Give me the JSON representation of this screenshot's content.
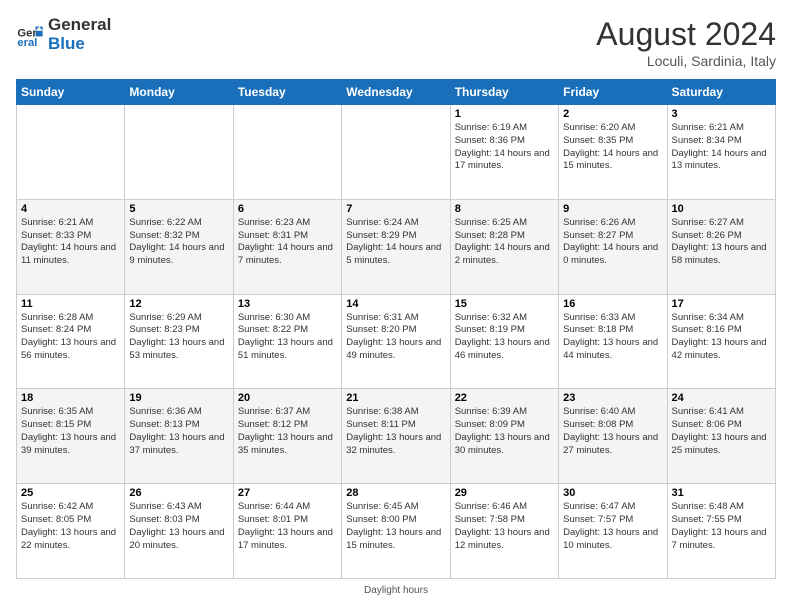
{
  "logo": {
    "line1": "General",
    "line2": "Blue"
  },
  "title": "August 2024",
  "subtitle": "Loculi, Sardinia, Italy",
  "footer": "Daylight hours",
  "weekdays": [
    "Sunday",
    "Monday",
    "Tuesday",
    "Wednesday",
    "Thursday",
    "Friday",
    "Saturday"
  ],
  "weeks": [
    [
      null,
      null,
      null,
      null,
      {
        "day": 1,
        "sunrise": "6:19 AM",
        "sunset": "8:36 PM",
        "daylight": "14 hours and 17 minutes."
      },
      {
        "day": 2,
        "sunrise": "6:20 AM",
        "sunset": "8:35 PM",
        "daylight": "14 hours and 15 minutes."
      },
      {
        "day": 3,
        "sunrise": "6:21 AM",
        "sunset": "8:34 PM",
        "daylight": "14 hours and 13 minutes."
      }
    ],
    [
      {
        "day": 4,
        "sunrise": "6:21 AM",
        "sunset": "8:33 PM",
        "daylight": "14 hours and 11 minutes."
      },
      {
        "day": 5,
        "sunrise": "6:22 AM",
        "sunset": "8:32 PM",
        "daylight": "14 hours and 9 minutes."
      },
      {
        "day": 6,
        "sunrise": "6:23 AM",
        "sunset": "8:31 PM",
        "daylight": "14 hours and 7 minutes."
      },
      {
        "day": 7,
        "sunrise": "6:24 AM",
        "sunset": "8:29 PM",
        "daylight": "14 hours and 5 minutes."
      },
      {
        "day": 8,
        "sunrise": "6:25 AM",
        "sunset": "8:28 PM",
        "daylight": "14 hours and 2 minutes."
      },
      {
        "day": 9,
        "sunrise": "6:26 AM",
        "sunset": "8:27 PM",
        "daylight": "14 hours and 0 minutes."
      },
      {
        "day": 10,
        "sunrise": "6:27 AM",
        "sunset": "8:26 PM",
        "daylight": "13 hours and 58 minutes."
      }
    ],
    [
      {
        "day": 11,
        "sunrise": "6:28 AM",
        "sunset": "8:24 PM",
        "daylight": "13 hours and 56 minutes."
      },
      {
        "day": 12,
        "sunrise": "6:29 AM",
        "sunset": "8:23 PM",
        "daylight": "13 hours and 53 minutes."
      },
      {
        "day": 13,
        "sunrise": "6:30 AM",
        "sunset": "8:22 PM",
        "daylight": "13 hours and 51 minutes."
      },
      {
        "day": 14,
        "sunrise": "6:31 AM",
        "sunset": "8:20 PM",
        "daylight": "13 hours and 49 minutes."
      },
      {
        "day": 15,
        "sunrise": "6:32 AM",
        "sunset": "8:19 PM",
        "daylight": "13 hours and 46 minutes."
      },
      {
        "day": 16,
        "sunrise": "6:33 AM",
        "sunset": "8:18 PM",
        "daylight": "13 hours and 44 minutes."
      },
      {
        "day": 17,
        "sunrise": "6:34 AM",
        "sunset": "8:16 PM",
        "daylight": "13 hours and 42 minutes."
      }
    ],
    [
      {
        "day": 18,
        "sunrise": "6:35 AM",
        "sunset": "8:15 PM",
        "daylight": "13 hours and 39 minutes."
      },
      {
        "day": 19,
        "sunrise": "6:36 AM",
        "sunset": "8:13 PM",
        "daylight": "13 hours and 37 minutes."
      },
      {
        "day": 20,
        "sunrise": "6:37 AM",
        "sunset": "8:12 PM",
        "daylight": "13 hours and 35 minutes."
      },
      {
        "day": 21,
        "sunrise": "6:38 AM",
        "sunset": "8:11 PM",
        "daylight": "13 hours and 32 minutes."
      },
      {
        "day": 22,
        "sunrise": "6:39 AM",
        "sunset": "8:09 PM",
        "daylight": "13 hours and 30 minutes."
      },
      {
        "day": 23,
        "sunrise": "6:40 AM",
        "sunset": "8:08 PM",
        "daylight": "13 hours and 27 minutes."
      },
      {
        "day": 24,
        "sunrise": "6:41 AM",
        "sunset": "8:06 PM",
        "daylight": "13 hours and 25 minutes."
      }
    ],
    [
      {
        "day": 25,
        "sunrise": "6:42 AM",
        "sunset": "8:05 PM",
        "daylight": "13 hours and 22 minutes."
      },
      {
        "day": 26,
        "sunrise": "6:43 AM",
        "sunset": "8:03 PM",
        "daylight": "13 hours and 20 minutes."
      },
      {
        "day": 27,
        "sunrise": "6:44 AM",
        "sunset": "8:01 PM",
        "daylight": "13 hours and 17 minutes."
      },
      {
        "day": 28,
        "sunrise": "6:45 AM",
        "sunset": "8:00 PM",
        "daylight": "13 hours and 15 minutes."
      },
      {
        "day": 29,
        "sunrise": "6:46 AM",
        "sunset": "7:58 PM",
        "daylight": "13 hours and 12 minutes."
      },
      {
        "day": 30,
        "sunrise": "6:47 AM",
        "sunset": "7:57 PM",
        "daylight": "13 hours and 10 minutes."
      },
      {
        "day": 31,
        "sunrise": "6:48 AM",
        "sunset": "7:55 PM",
        "daylight": "13 hours and 7 minutes."
      }
    ]
  ]
}
